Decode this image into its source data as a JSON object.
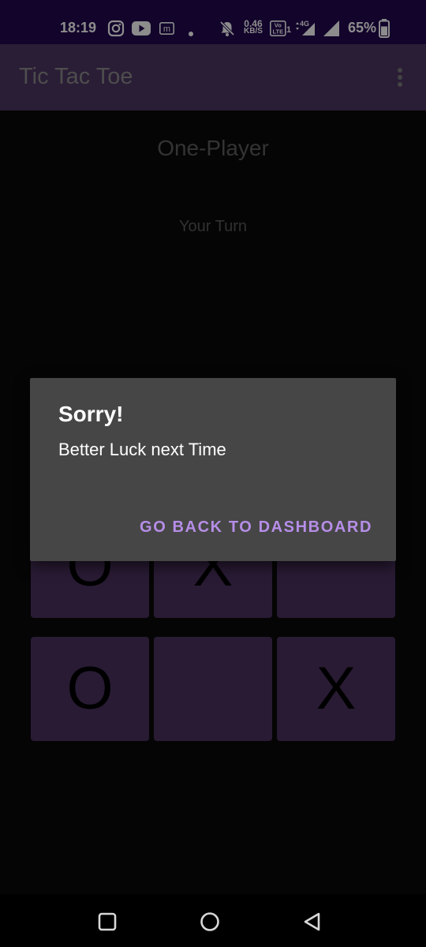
{
  "status_bar": {
    "time": "18:19",
    "icons": [
      "instagram-icon",
      "youtube-icon",
      "m-app-icon",
      "dot-icon",
      "mute-bell-icon",
      "volte-icon",
      "4g-icon",
      "signal-icon",
      "battery-icon"
    ],
    "net_speed_value": "0.46",
    "net_speed_unit": "KB/S",
    "volte_label": "Vo LTE",
    "network_label": "4G",
    "sim_number": "1",
    "battery_percent": "65%"
  },
  "app_bar": {
    "title": "Tic Tac Toe",
    "menu_icon": "overflow-menu-icon"
  },
  "game": {
    "mode_title": "One-Player",
    "turn_text": "Your Turn",
    "board": [
      [
        "O",
        "X",
        ""
      ],
      [
        "O",
        "",
        "X"
      ]
    ]
  },
  "dialog": {
    "title": "Sorry!",
    "message": "Better Luck next Time",
    "button_label": "GO BACK TO DASHBOARD"
  },
  "nav_bar": {
    "buttons": [
      "recents-square-icon",
      "home-circle-icon",
      "back-triangle-icon"
    ]
  },
  "colors": {
    "status_bar_bg": "#21084f",
    "app_bar_bg": "#4e3563",
    "cell_bg": "#4b325f",
    "dialog_bg": "#464646",
    "accent": "#b68ee8"
  }
}
